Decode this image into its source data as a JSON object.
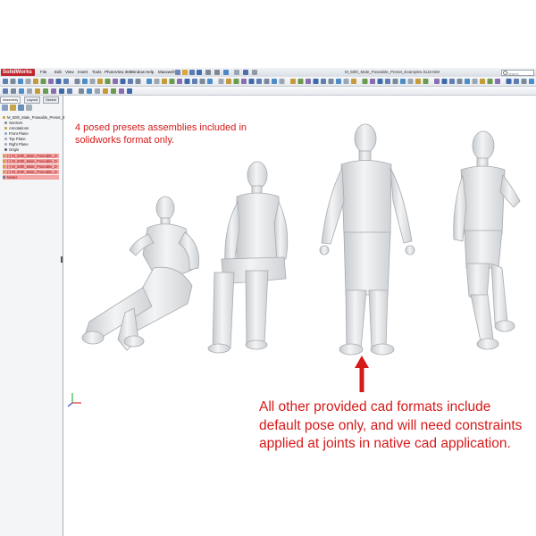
{
  "app": {
    "logo_text": "SolidWorks",
    "menu": [
      "File",
      "Edit",
      "View",
      "Insert",
      "Tools",
      "PhotoView 360",
      "Window",
      "Help",
      "Maxxwell"
    ],
    "document_title": "M_50th_Male_Poseable_Preset_Examples.SLDASM",
    "search_placeholder": "Search Knowledge B"
  },
  "feature_manager": {
    "tabs": [
      "Assembly",
      "Layout",
      "Sketch"
    ],
    "tree": [
      {
        "label": "M_50th_Male_Poseable_Preset_E",
        "selected": false
      },
      {
        "label": "Sensors",
        "selected": false
      },
      {
        "label": "Annotations",
        "selected": false
      },
      {
        "label": "Front Plane",
        "selected": false
      },
      {
        "label": "Top Plane",
        "selected": false
      },
      {
        "label": "Right Plane",
        "selected": false
      },
      {
        "label": "Origin",
        "selected": false
      },
      {
        "label": "(-) M_50th_Male_Poseable_D",
        "selected": true
      },
      {
        "label": "(-) M_50th_Male_Poseable_D",
        "selected": true
      },
      {
        "label": "(-) M_50th_Male_Poseable_D",
        "selected": true
      },
      {
        "label": "(-) M_50th_Male_Poseable_D",
        "selected": true
      },
      {
        "label": "Mates",
        "selected": true
      }
    ]
  },
  "viewport": {
    "annotation_top": "4 posed presets assemblies included in solidworks format only.",
    "annotation_bottom": "All other provided cad formats include default pose only, and will need constraints applied at joints in native cad application.",
    "annotation_color": "#d61a1a",
    "figures": [
      "seated-reclined",
      "seated-upright",
      "standing-default",
      "walking"
    ]
  }
}
